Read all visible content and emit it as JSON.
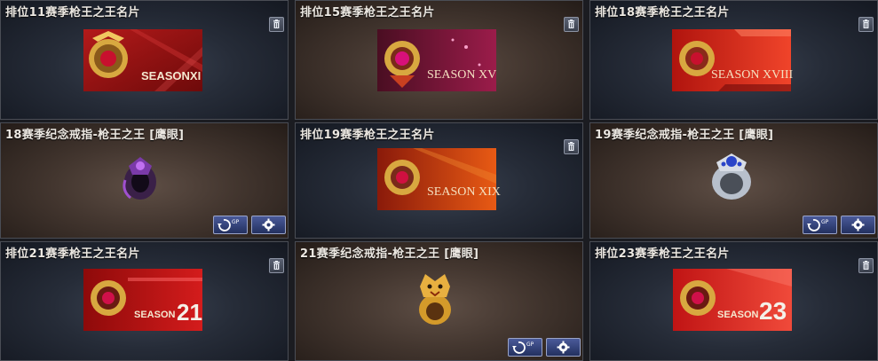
{
  "cards": [
    {
      "title": "排位11赛季枪王之王名片",
      "season_text": "SEASONXI"
    },
    {
      "title": "排位15赛季枪王之王名片",
      "season_text": "SEASON XV"
    },
    {
      "title": "排位18赛季枪王之王名片",
      "season_text": "SEASON XVIII"
    },
    {
      "title": "18赛季纪念戒指-枪王之王 [鹰眼]"
    },
    {
      "title": "排位19赛季枪王之王名片",
      "season_text": "SEASON XIX"
    },
    {
      "title": "19赛季纪念戒指-枪王之王 [鹰眼]"
    },
    {
      "title": "排位21赛季枪王之王名片",
      "season_text": "SEASON",
      "season_number": "21"
    },
    {
      "title": "21赛季纪念戒指-枪王之王  [鹰眼]"
    },
    {
      "title": "排位23赛季枪王之王名片",
      "season_text": "SEASON",
      "season_number": "23"
    }
  ],
  "buttons": {
    "gp_label": "GP"
  },
  "icons": {
    "delete": "trash-icon",
    "convert": "gp-convert-icon",
    "settings": "gear-icon"
  }
}
